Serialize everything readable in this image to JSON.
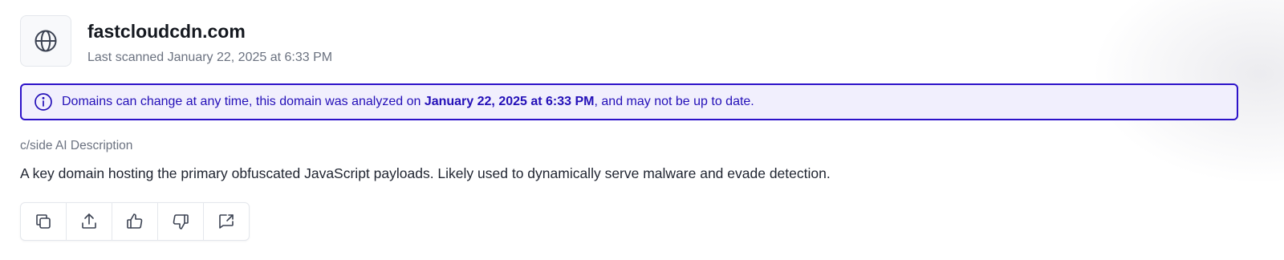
{
  "domain": {
    "name": "fastcloudcdn.com",
    "last_scanned": "Last scanned January 22, 2025 at 6:33 PM",
    "icon": "globe-icon"
  },
  "notice": {
    "icon": "info-icon",
    "text_before": "Domains can change at any time, this domain was analyzed on ",
    "date_bold": "January 22, 2025 at 6:33 PM",
    "text_after": ", and may not be up to date."
  },
  "description": {
    "label": "c/side AI Description",
    "text": "A key domain hosting the primary obfuscated JavaScript payloads. Likely used to dynamically serve malware and evade detection."
  },
  "actions": [
    {
      "icon": "copy-icon"
    },
    {
      "icon": "share-icon"
    },
    {
      "icon": "thumbs-up-icon"
    },
    {
      "icon": "thumbs-down-icon"
    },
    {
      "icon": "feedback-icon"
    }
  ],
  "colors": {
    "notice_border": "#2d12c9",
    "notice_bg": "#f1effd",
    "notice_text": "#2410b8",
    "muted_text": "#6b7280"
  }
}
